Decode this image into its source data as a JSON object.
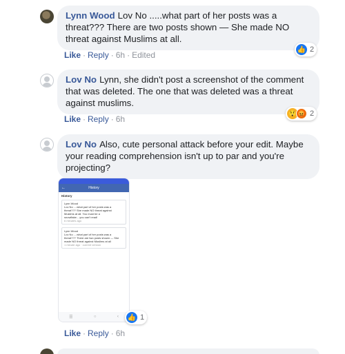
{
  "comments": [
    {
      "author": "Lynn Wood",
      "text": "Lov No .....what part of her posts was a threat??? There are two posts shown — She made NO threat against Muslims at all.",
      "like": "Like",
      "reply": "Reply",
      "time": "6h",
      "edited": "Edited",
      "reaction_count": "2"
    },
    {
      "author": "Lov No",
      "text": "Lynn, she didn't post a screenshot of the comment that was deleted. The one that was deleted was a threat against muslims.",
      "like": "Like",
      "reply": "Reply",
      "time": "6h",
      "reaction_count": "2"
    },
    {
      "author": "Lov No",
      "text": "Also, cute personal attack before your edit. Maybe your reading comprehension isn't up to par and you're projecting?",
      "like": "Like",
      "reply": "Reply",
      "time": "6h",
      "reaction_count": "1"
    }
  ],
  "screenshot": {
    "header": "History",
    "section": "History",
    "items": [
      {
        "name": "Lynn Wood",
        "lines": [
          "Lov No ....what part of her posts was a",
          "threat??? She made NO threat against",
          "Muslims at all. You must be a",
          "snowflake... you can't read!"
        ],
        "meta": "6 minutes ago"
      },
      {
        "name": "Lynn Wood",
        "lines": [
          "Lov No ....what part of her posts was a",
          "threat??? There are two posts shown — She",
          "made NO threat against Muslims at all"
        ],
        "meta": "1 minute ago · current version"
      }
    ]
  },
  "colors": {
    "link": "#385898",
    "bubble": "#f0f2f5",
    "like_blue": "#1877f2"
  },
  "icons": {
    "like": "like-reaction-icon",
    "wow": "wow-reaction-icon",
    "angry": "angry-reaction-icon"
  }
}
